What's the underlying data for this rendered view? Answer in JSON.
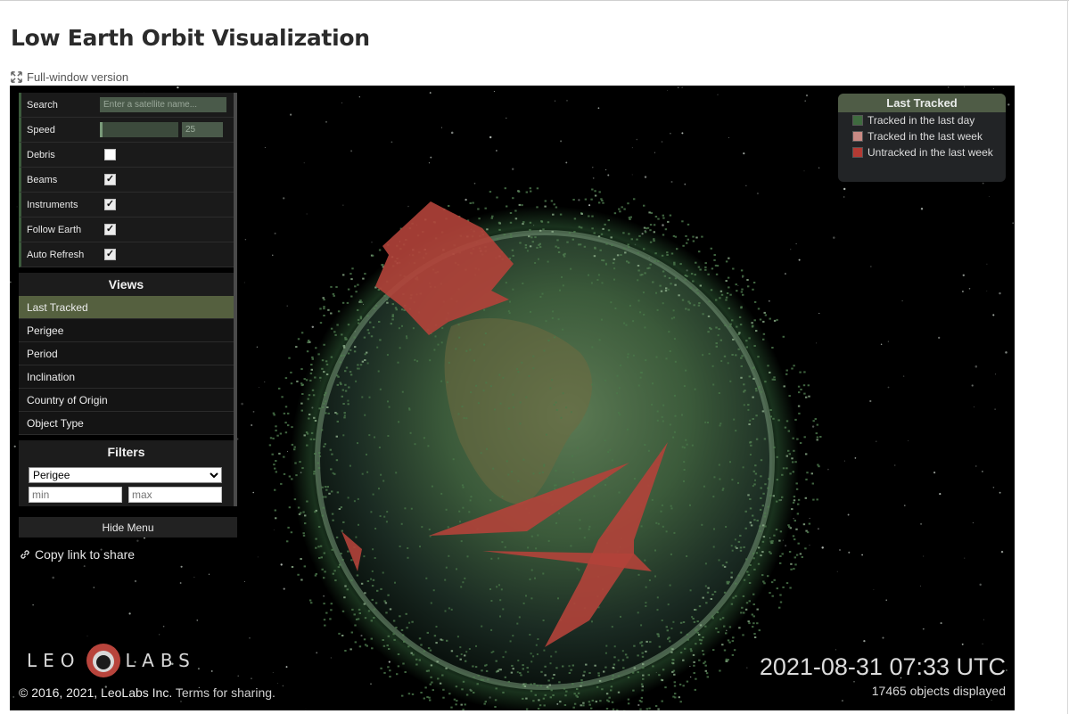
{
  "page": {
    "title": "Low Earth Orbit Visualization",
    "fullwindow_label": "Full-window version"
  },
  "controls": {
    "search_label": "Search",
    "search_placeholder": "Enter a satellite name...",
    "speed_label": "Speed",
    "speed_value": "25",
    "toggles": [
      {
        "label": "Debris",
        "checked": false
      },
      {
        "label": "Beams",
        "checked": true
      },
      {
        "label": "Instruments",
        "checked": true
      },
      {
        "label": "Follow Earth",
        "checked": true
      },
      {
        "label": "Auto Refresh",
        "checked": true
      }
    ]
  },
  "views": {
    "heading": "Views",
    "items": [
      "Last Tracked",
      "Perigee",
      "Period",
      "Inclination",
      "Country of Origin",
      "Object Type"
    ],
    "active": "Last Tracked"
  },
  "filters": {
    "heading": "Filters",
    "selected": "Perigee",
    "min_placeholder": "min",
    "max_placeholder": "max"
  },
  "hide_menu_label": "Hide Menu",
  "copy_link_label": "Copy link to share",
  "legend": {
    "title": "Last Tracked",
    "items": [
      {
        "label": "Tracked in the last day",
        "color": "#3f6b3f"
      },
      {
        "label": "Tracked in the last week",
        "color": "#c98a84"
      },
      {
        "label": "Untracked in the last week",
        "color": "#b43a33"
      }
    ]
  },
  "logo": {
    "left": "LEO",
    "right": "LABS"
  },
  "footer": {
    "copyright": "© 2016, 2021, LeoLabs Inc.",
    "terms": "Terms for sharing.",
    "datetime": "2021-08-31 07:33 UTC",
    "objects": "17465 objects displayed"
  },
  "colors": {
    "tracked_day": "#3f6b3f",
    "tracked_week": "#c98a84",
    "untracked": "#b43a33",
    "panel_active": "#55603f"
  }
}
